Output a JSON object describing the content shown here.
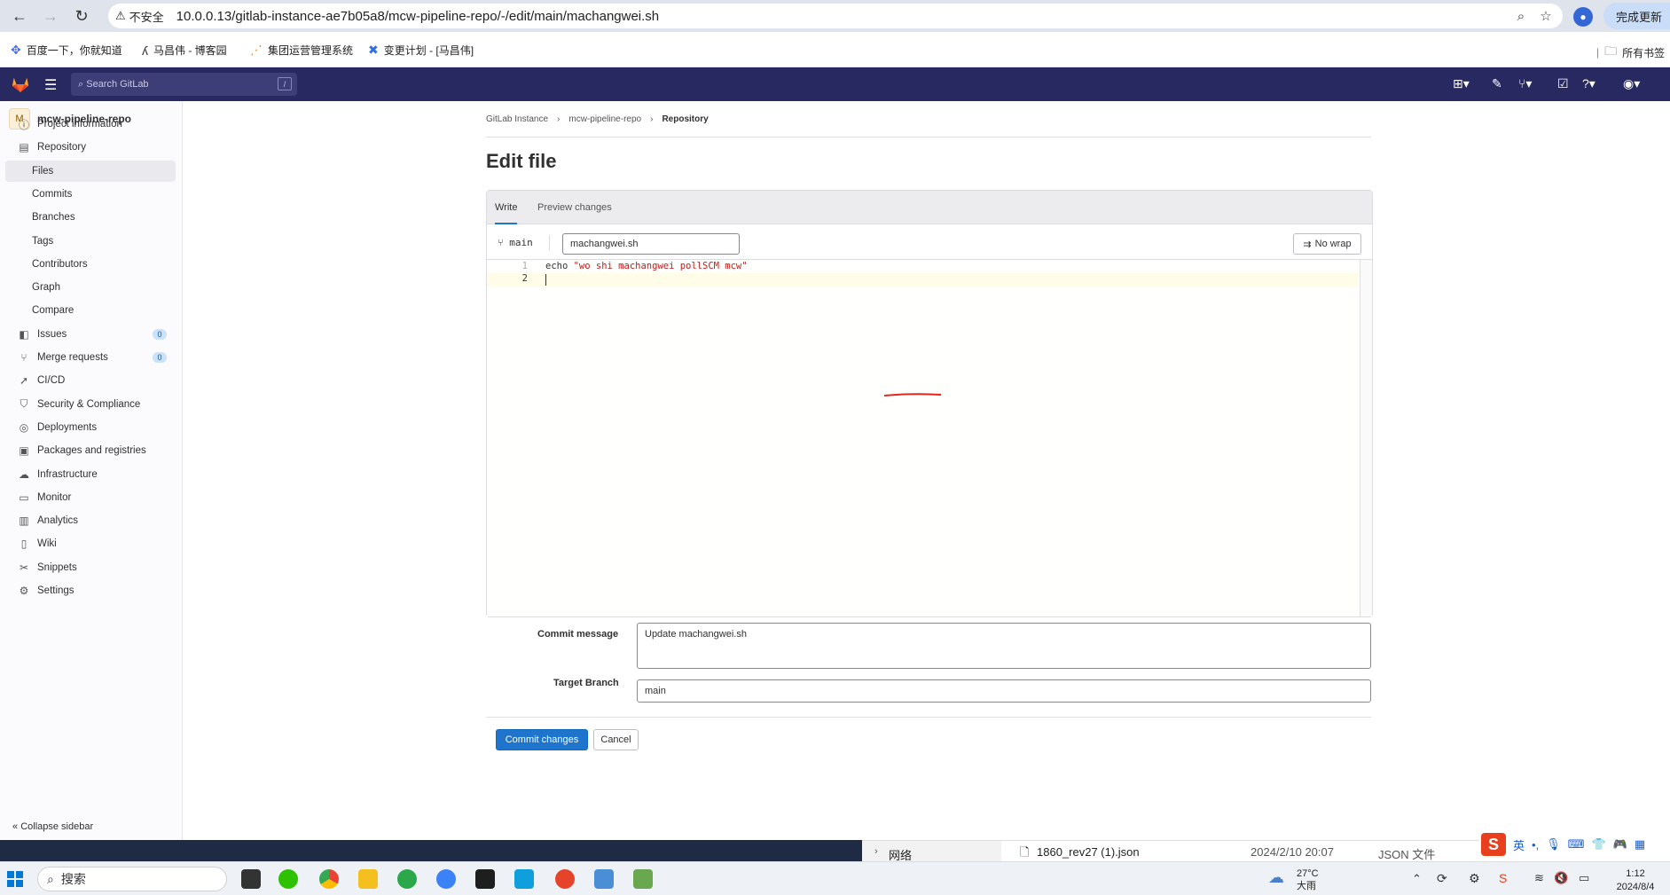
{
  "browser": {
    "security_label": "不安全",
    "url": "10.0.0.13/gitlab-instance-ae7b05a8/mcw-pipeline-repo/-/edit/main/machangwei.sh",
    "update_label": "完成更新",
    "bookmarks": [
      "百度一下，你就知道",
      "马昌伟 - 博客园",
      "集团运营管理系统",
      "变更计划 - [马昌伟]"
    ],
    "all_bookmarks": "所有书签"
  },
  "gitlab": {
    "search_placeholder": "Search GitLab",
    "search_shortcut": "/"
  },
  "sidebar": {
    "project_initial": "M",
    "project_name": "mcw-pipeline-repo",
    "items": [
      {
        "label": "Project information",
        "icon": "info-icon"
      },
      {
        "label": "Repository",
        "icon": "repository-icon"
      },
      {
        "label": "Files",
        "sub": true,
        "active": true
      },
      {
        "label": "Commits",
        "sub": true
      },
      {
        "label": "Branches",
        "sub": true
      },
      {
        "label": "Tags",
        "sub": true
      },
      {
        "label": "Contributors",
        "sub": true
      },
      {
        "label": "Graph",
        "sub": true
      },
      {
        "label": "Compare",
        "sub": true
      },
      {
        "label": "Issues",
        "icon": "issues-icon",
        "badge": "0"
      },
      {
        "label": "Merge requests",
        "icon": "merge-request-icon",
        "badge": "0"
      },
      {
        "label": "CI/CD",
        "icon": "rocket-icon"
      },
      {
        "label": "Security & Compliance",
        "icon": "shield-icon"
      },
      {
        "label": "Deployments",
        "icon": "deployments-icon"
      },
      {
        "label": "Packages and registries",
        "icon": "package-icon"
      },
      {
        "label": "Infrastructure",
        "icon": "cloud-icon"
      },
      {
        "label": "Monitor",
        "icon": "monitor-icon"
      },
      {
        "label": "Analytics",
        "icon": "chart-icon"
      },
      {
        "label": "Wiki",
        "icon": "book-icon"
      },
      {
        "label": "Snippets",
        "icon": "snippet-icon"
      },
      {
        "label": "Settings",
        "icon": "gear-icon"
      }
    ],
    "collapse_label": "Collapse sidebar"
  },
  "breadcrumb": [
    "GitLab Instance",
    "mcw-pipeline-repo",
    "Repository"
  ],
  "page_title": "Edit file",
  "editor": {
    "tab_write": "Write",
    "tab_preview": "Preview changes",
    "branch": "main",
    "file_name": "machangwei.sh",
    "nowrap_label": "No wrap",
    "line1_num": "1",
    "line1_cmd": "echo ",
    "line1_str": "\"wo shi machangwei pollSCM mcw\"",
    "line2_num": "2"
  },
  "form": {
    "commit_message_label": "Commit message",
    "commit_message": "Update machangwei.sh",
    "target_branch_label": "Target Branch",
    "target_branch": "main",
    "commit_button": "Commit changes",
    "cancel_button": "Cancel"
  },
  "explorer_row": {
    "nav_label": "网络",
    "file": "1860_rev27 (1).json",
    "date": "2024/2/10 20:07",
    "type": "JSON 文件"
  },
  "ime": {
    "lang": "英",
    "punct": "•,"
  },
  "taskbar": {
    "search_label": "搜索",
    "temp": "27°C",
    "weather": "大雨",
    "time": "1:12",
    "date": "2024/8/4"
  }
}
